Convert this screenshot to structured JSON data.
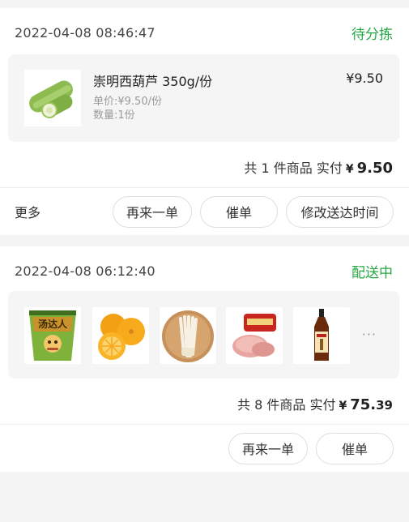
{
  "orders": [
    {
      "time": "2022-04-08 08:46:47",
      "status": "待分拣",
      "item": {
        "name": "崇明西葫芦 350g/份",
        "price": "¥9.50",
        "unit_price": "单价:¥9.50/份",
        "quantity": "数量:1份",
        "image_icon": "zucchini-image"
      },
      "summary": {
        "count_text": "共 1 件商品 实付",
        "yen": "¥",
        "amount": "9.50"
      },
      "more_label": "更多",
      "buttons": [
        "再来一单",
        "催单",
        "修改送达时间"
      ]
    },
    {
      "time": "2022-04-08 06:12:40",
      "status": "配送中",
      "thumbs": [
        "noodle-cup-image",
        "orange-image",
        "enoki-mushroom-image",
        "luncheon-meat-image",
        "cooking-wine-image"
      ],
      "thumb_text": "汤达人",
      "more_thumbs": "···",
      "summary": {
        "count_text": "共 8 件商品 实付",
        "yen": "¥",
        "amount_main": "75.",
        "amount_small": "39"
      },
      "buttons": [
        "再来一单",
        "催单"
      ]
    }
  ],
  "colors": {
    "status_green": "#27a745",
    "background": "#f3f3f3"
  }
}
